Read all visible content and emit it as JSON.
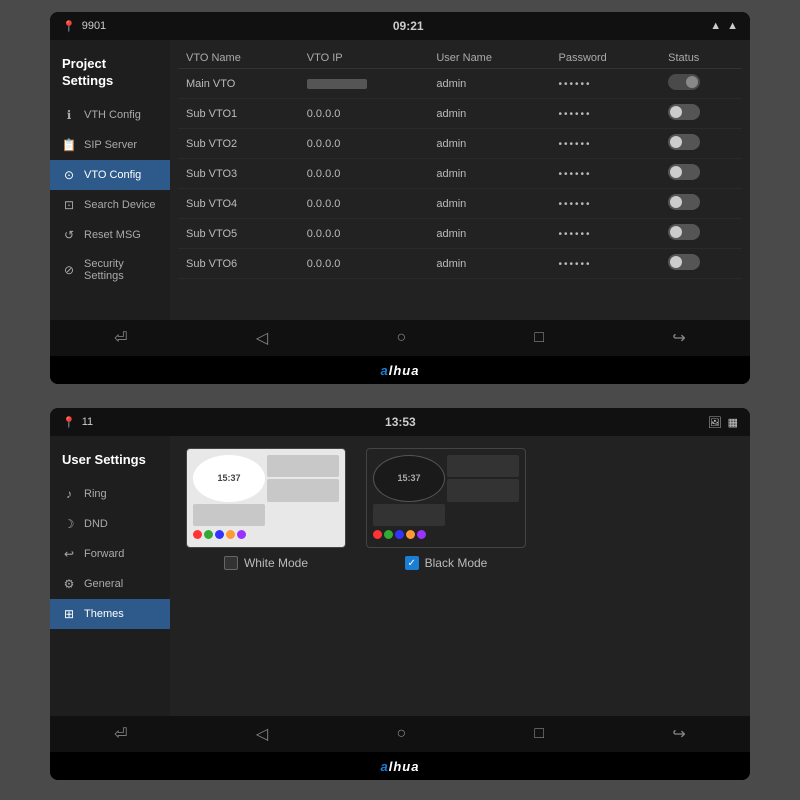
{
  "screen1": {
    "statusBar": {
      "signal": "9901",
      "time": "09:21",
      "icons": [
        "▲",
        "▲"
      ]
    },
    "sidebar": {
      "title": "Project Settings",
      "items": [
        {
          "id": "vth-config",
          "label": "VTH Config",
          "icon": "ℹ",
          "active": false
        },
        {
          "id": "sip-server",
          "label": "SIP Server",
          "icon": "🖫",
          "active": false
        },
        {
          "id": "vto-config",
          "label": "VTO Config",
          "icon": "⊙",
          "active": true
        },
        {
          "id": "search-device",
          "label": "Search Device",
          "icon": "⊡",
          "active": false
        },
        {
          "id": "reset-msg",
          "label": "Reset MSG",
          "icon": "↺",
          "active": false
        },
        {
          "id": "security-settings",
          "label": "Security Settings",
          "icon": "⊘",
          "active": false
        }
      ]
    },
    "table": {
      "headers": [
        "VTO Name",
        "VTO IP",
        "User Name",
        "Password",
        "Status"
      ],
      "rows": [
        {
          "name": "Main VTO",
          "ip": "blur",
          "user": "admin",
          "pass": "••••••",
          "status": true
        },
        {
          "name": "Sub VTO1",
          "ip": "0.0.0.0",
          "user": "admin",
          "pass": "••••••",
          "status": false
        },
        {
          "name": "Sub VTO2",
          "ip": "0.0.0.0",
          "user": "admin",
          "pass": "••••••",
          "status": false
        },
        {
          "name": "Sub VTO3",
          "ip": "0.0.0.0",
          "user": "admin",
          "pass": "••••••",
          "status": false
        },
        {
          "name": "Sub VTO4",
          "ip": "0.0.0.0",
          "user": "admin",
          "pass": "••••••",
          "status": false
        },
        {
          "name": "Sub VTO5",
          "ip": "0.0.0.0",
          "user": "admin",
          "pass": "••••••",
          "status": false
        },
        {
          "name": "Sub VTO6",
          "ip": "0.0.0.0",
          "user": "admin",
          "pass": "••••••",
          "status": false
        }
      ]
    },
    "nav": [
      "⏎",
      "◁",
      "○",
      "□",
      "↪"
    ],
    "brand": "alhua"
  },
  "screen2": {
    "statusBar": {
      "signal": "11",
      "time": "13:53",
      "icons": [
        "🖼",
        "▦"
      ]
    },
    "sidebar": {
      "title": "User Settings",
      "items": [
        {
          "id": "ring",
          "label": "Ring",
          "icon": "♪",
          "active": false
        },
        {
          "id": "dnd",
          "label": "DND",
          "icon": "☽",
          "active": false
        },
        {
          "id": "forward",
          "label": "Forward",
          "icon": "↩",
          "active": false
        },
        {
          "id": "general",
          "label": "General",
          "icon": "⚙",
          "active": false
        },
        {
          "id": "themes",
          "label": "Themes",
          "icon": "⊞",
          "active": true
        }
      ]
    },
    "themes": {
      "whiteMode": {
        "label": "White Mode",
        "checked": false,
        "time": "15:37"
      },
      "blackMode": {
        "label": "Black Mode",
        "checked": true,
        "time": "15:37"
      }
    },
    "nav": [
      "⏎",
      "◁",
      "○",
      "□",
      "↪"
    ],
    "brand": "alhua"
  }
}
